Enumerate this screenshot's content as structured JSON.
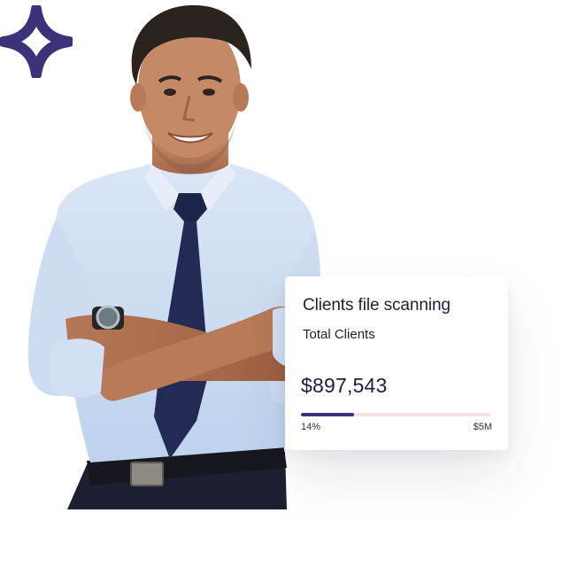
{
  "card": {
    "title": "Clients file scanning",
    "subtitle": "Total Clients",
    "amount": "$897,543",
    "progress": {
      "fraction": 0.28,
      "min_label": "14%",
      "max_label": "$5M"
    }
  },
  "decor": {
    "sparkle_icon": "four-point-star-icon",
    "accent_color": "#3a3379",
    "track_color": "#f5e3e8"
  }
}
